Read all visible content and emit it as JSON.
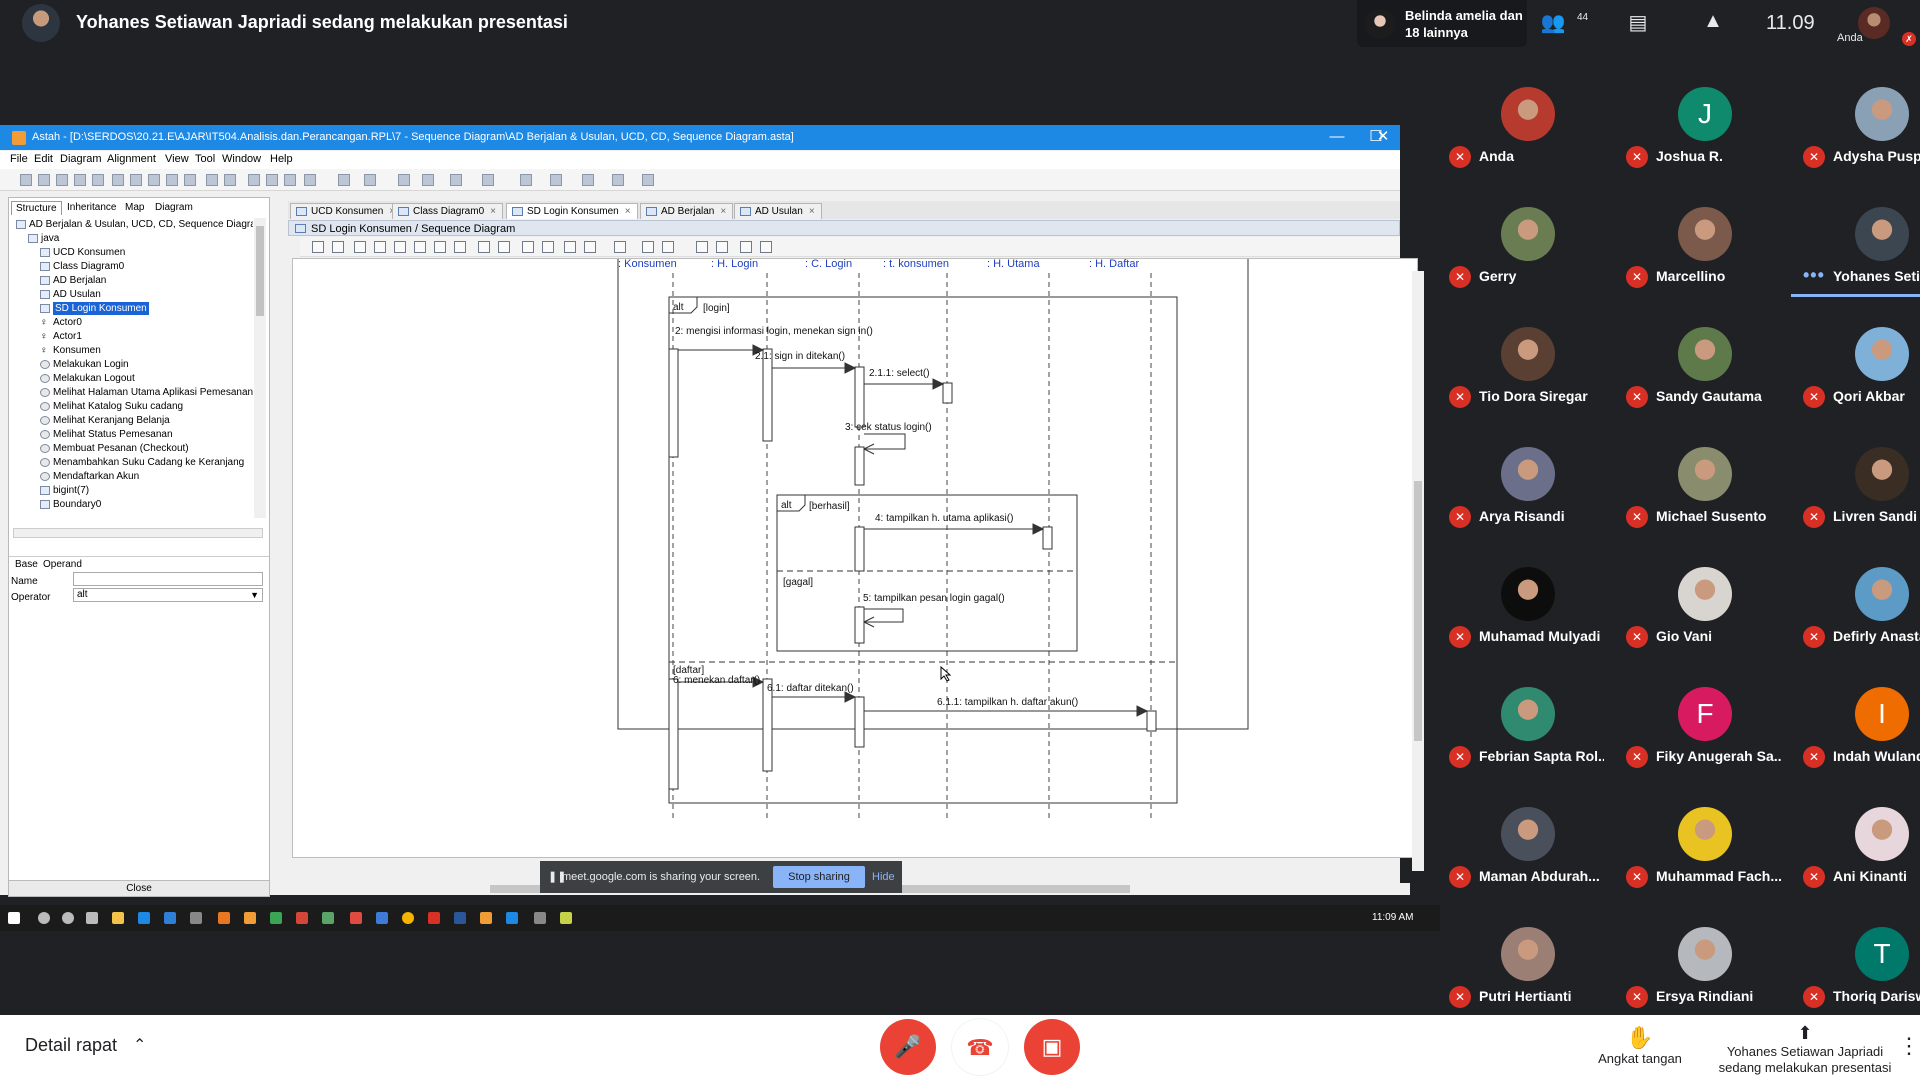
{
  "header": {
    "presenting_title": "Yohanes Setiawan Japriadi sedang melakukan presentasi",
    "notification": "Belinda amelia dan 18 lainnya",
    "people_count": "44",
    "clock": "11.09",
    "self_label": "Anda"
  },
  "astah": {
    "window_title": "Astah - [D:\\SERDOS\\20.21.E\\AJAR\\IT504.Analisis.dan.Perancangan.RPL\\7 - Sequence Diagram\\AD Berjalan & Usulan, UCD, CD, Sequence Diagram.asta]",
    "menu": [
      "File",
      "Edit",
      "Diagram",
      "Alignment",
      "View",
      "Tool",
      "Window",
      "Help"
    ],
    "left_tabs": [
      "Structure",
      "Inheritance",
      "Map",
      "Diagram"
    ],
    "tree": [
      {
        "label": "AD Berjalan & Usulan, UCD, CD, Sequence Diagra",
        "icon": "project",
        "indent": 0
      },
      {
        "label": "java",
        "icon": "folder",
        "indent": 1
      },
      {
        "label": "UCD Konsumen",
        "icon": "diagram",
        "indent": 2
      },
      {
        "label": "Class Diagram0",
        "icon": "diagram",
        "indent": 2
      },
      {
        "label": "AD Berjalan",
        "icon": "diagram",
        "indent": 2
      },
      {
        "label": "AD Usulan",
        "icon": "diagram",
        "indent": 2
      },
      {
        "label": "SD Login Konsumen",
        "icon": "diagram",
        "indent": 2,
        "selected": true
      },
      {
        "label": "Actor0",
        "icon": "actor",
        "indent": 2
      },
      {
        "label": "Actor1",
        "icon": "actor",
        "indent": 2
      },
      {
        "label": "Konsumen",
        "icon": "actor",
        "indent": 2
      },
      {
        "label": "Melakukan Login",
        "icon": "usecase",
        "indent": 2
      },
      {
        "label": "Melakukan Logout",
        "icon": "usecase",
        "indent": 2
      },
      {
        "label": "Melihat Halaman Utama Aplikasi Pemesanan S",
        "icon": "usecase",
        "indent": 2
      },
      {
        "label": "Melihat Katalog Suku cadang",
        "icon": "usecase",
        "indent": 2
      },
      {
        "label": "Melihat Keranjang Belanja",
        "icon": "usecase",
        "indent": 2
      },
      {
        "label": "Melihat Status Pemesanan",
        "icon": "usecase",
        "indent": 2
      },
      {
        "label": "Membuat Pesanan (Checkout)",
        "icon": "usecase",
        "indent": 2
      },
      {
        "label": "Menambahkan Suku Cadang ke Keranjang",
        "icon": "usecase",
        "indent": 2
      },
      {
        "label": "Mendaftarkan Akun",
        "icon": "usecase",
        "indent": 2
      },
      {
        "label": "bigint(7)",
        "icon": "class",
        "indent": 2
      },
      {
        "label": "Boundary0",
        "icon": "boundary",
        "indent": 2
      }
    ],
    "props_tabs": [
      "Base",
      "Operand"
    ],
    "name_label": "Name",
    "operator_label": "Operator",
    "operator_value": "alt",
    "close_label": "Close",
    "doc_tabs": [
      {
        "label": "UCD Konsumen",
        "active": false
      },
      {
        "label": "Class Diagram0",
        "active": false
      },
      {
        "label": "SD Login Konsumen",
        "active": true
      },
      {
        "label": "AD Berjalan",
        "active": false
      },
      {
        "label": "AD Usulan",
        "active": false
      }
    ],
    "diagram_title": "SD Login Konsumen / Sequence Diagram"
  },
  "sequence": {
    "lifelines": [
      ": Konsumen",
      ": H. Login",
      ": C. Login",
      ": t. konsumen",
      ": H. Utama",
      ": H. Daftar"
    ],
    "fragment_alt": "alt",
    "guard_login": "[login]",
    "guard_berhasil": "[berhasil]",
    "guard_gagal": "[gagal]",
    "guard_daftar": "[daftar]",
    "messages": {
      "m2": "2: mengisi informasi login, menekan sign in()",
      "m21": "2.1: sign in ditekan()",
      "m211": "2.1.1: select()",
      "m3": "3: cek status login()",
      "m4": "4: tampilkan h. utama aplikasi()",
      "m5": "5: tampilkan pesan login gagal()",
      "m6": "6: menekan daftar()",
      "m61": "6.1: daftar ditekan()",
      "m611": "6.1.1: tampilkan h. daftar akun()"
    }
  },
  "share_banner": {
    "text": "meet.google.com is sharing your screen.",
    "stop": "Stop sharing",
    "hide": "Hide"
  },
  "taskbar": {
    "time": "11:09 AM"
  },
  "participants": [
    {
      "name": "Anda",
      "color": "#b73a2f"
    },
    {
      "name": "Joshua R.",
      "initial": "J",
      "color": "#0f8a6c"
    },
    {
      "name": "Adysha Puspa De...",
      "color": "#8aa1b5"
    },
    {
      "name": "Gerry",
      "color": "#6a7d52"
    },
    {
      "name": "Marcellino",
      "color": "#7b5a4c"
    },
    {
      "name": "Yohanes Setiawa...",
      "color": "#3b4651",
      "speaking": true
    },
    {
      "name": "Tio Dora Siregar",
      "color": "#5a4033"
    },
    {
      "name": "Sandy Gautama",
      "color": "#5f7a4a"
    },
    {
      "name": "Qori Akbar",
      "color": "#7fb0d8"
    },
    {
      "name": "Arya Risandi",
      "color": "#6b6f8a"
    },
    {
      "name": "Michael Susento",
      "color": "#8a8c6e"
    },
    {
      "name": "Livren Sandi",
      "color": "#3a2d24"
    },
    {
      "name": "Muhamad Mulyadi",
      "color": "#0d0d0d"
    },
    {
      "name": "Gio Vani",
      "color": "#d8d4d0"
    },
    {
      "name": "Defirly Anastasya",
      "color": "#5c9bc6"
    },
    {
      "name": "Febrian Sapta Rol...",
      "color": "#2f8a6f"
    },
    {
      "name": "Fiky Anugerah Sa...",
      "initial": "F",
      "color": "#d81b60"
    },
    {
      "name": "Indah Wulandari",
      "initial": "I",
      "color": "#ef6c00"
    },
    {
      "name": "Maman Abdurah...",
      "color": "#4a4f5c"
    },
    {
      "name": "Muhammad Fach...",
      "color": "#e8c322"
    },
    {
      "name": "Ani Kinanti",
      "color": "#e7d6dc"
    },
    {
      "name": "Putri Hertianti",
      "color": "#9b7e74"
    },
    {
      "name": "Ersya Rindiani",
      "color": "#b5b9bd"
    },
    {
      "name": "Thoriq Dariswans...",
      "initial": "T",
      "color": "#00796b"
    }
  ],
  "bottom": {
    "meeting_details": "Detail rapat",
    "raise_hand": "Angkat tangan",
    "presenting_line1": "Yohanes Setiawan Japriadi",
    "presenting_line2": "sedang melakukan presentasi"
  }
}
